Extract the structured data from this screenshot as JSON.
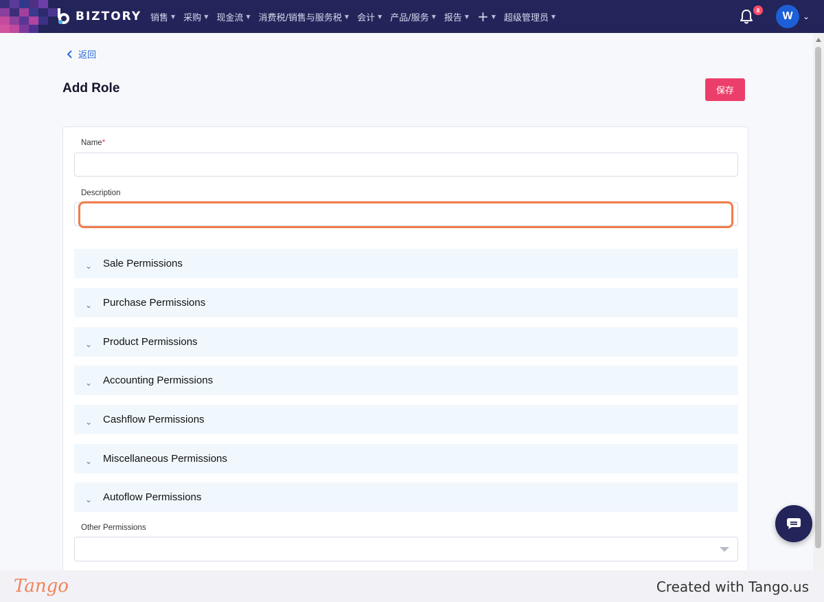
{
  "brand": {
    "name": "BIZTORY"
  },
  "nav": {
    "items": [
      "销售",
      "采购",
      "现金流",
      "消费税/销售与服务税",
      "会计",
      "产品/服务",
      "报告"
    ],
    "admin": "超级管理员",
    "notification_count": "8",
    "avatar_initial": "W"
  },
  "page": {
    "back_label": "返回",
    "title": "Add Role",
    "save_label": "保存"
  },
  "form": {
    "name_label": "Name",
    "required_mark": "*",
    "name_value": "",
    "description_label": "Description",
    "description_value": "",
    "permissions": [
      "Sale Permissions",
      "Purchase Permissions",
      "Product Permissions",
      "Accounting Permissions",
      "Cashflow Permissions",
      "Miscellaneous Permissions",
      "Autoflow Permissions"
    ],
    "other_label": "Other Permissions",
    "other_value": ""
  },
  "footer": {
    "logo": "Tango",
    "credit": "Created with Tango.us"
  },
  "colors": {
    "navbar": "#23245a",
    "save_button": "#ec3e6a",
    "link": "#2b6bd6",
    "highlight": "#f07b4c",
    "permission_row": "#f1f8fd"
  }
}
